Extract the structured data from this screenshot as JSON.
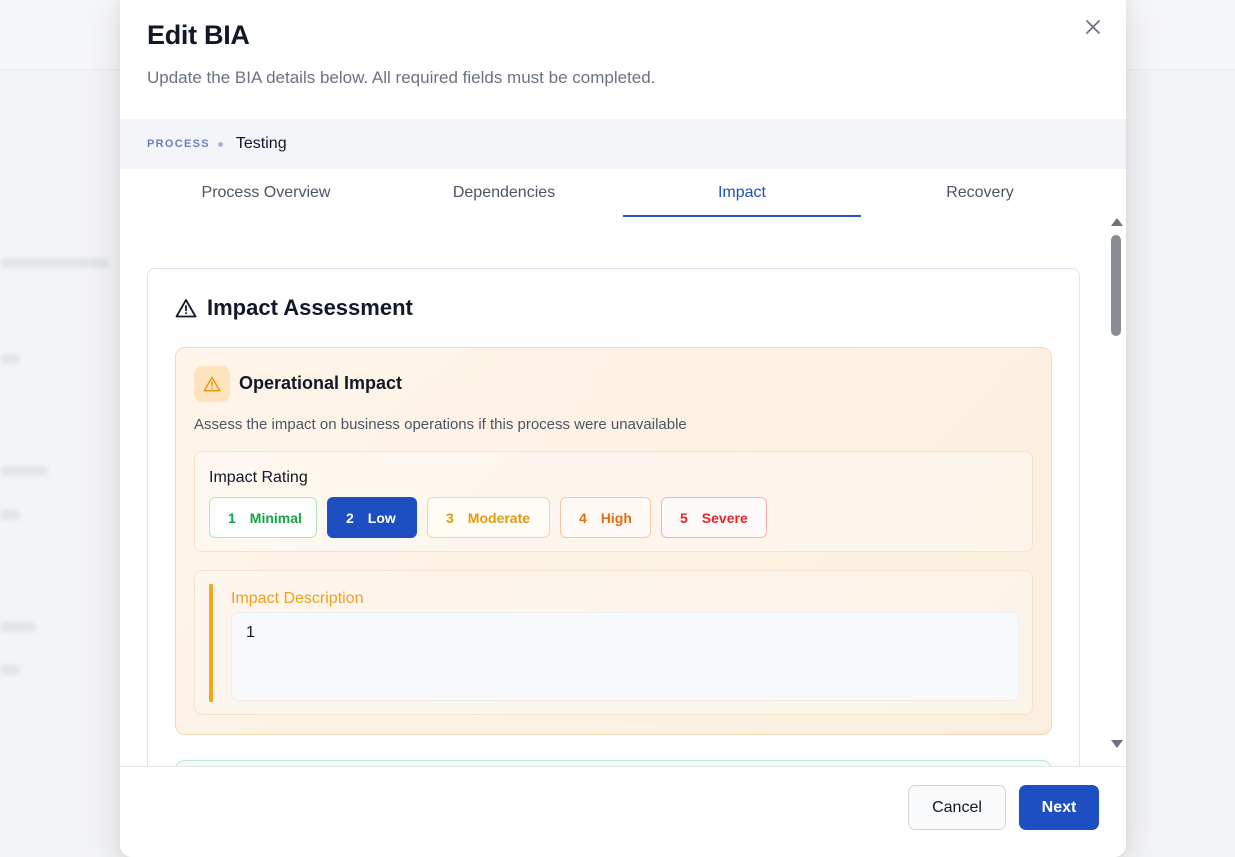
{
  "modal": {
    "title": "Edit BIA",
    "subtitle": "Update the BIA details below. All required fields must be completed.",
    "close_icon": "close-icon"
  },
  "process": {
    "label": "PROCESS",
    "name": "Testing"
  },
  "tabs": [
    {
      "label": "Process Overview",
      "active": false
    },
    {
      "label": "Dependencies",
      "active": false
    },
    {
      "label": "Impact",
      "active": true
    },
    {
      "label": "Recovery",
      "active": false
    }
  ],
  "impact_assessment": {
    "title": "Impact Assessment",
    "icon": "warning-triangle-icon",
    "operational": {
      "title": "Operational Impact",
      "icon": "warning-icon",
      "description": "Assess the impact on business operations if this process were unavailable",
      "rating_label": "Impact Rating",
      "ratings": [
        {
          "num": "1",
          "label": "Minimal",
          "color": "#16a34a",
          "selected": false
        },
        {
          "num": "2",
          "label": "Low",
          "color": "#1e4fc2",
          "selected": true
        },
        {
          "num": "3",
          "label": "Moderate",
          "color": "#e39a0f",
          "selected": false
        },
        {
          "num": "4",
          "label": "High",
          "color": "#ea6b10",
          "selected": false
        },
        {
          "num": "5",
          "label": "Severe",
          "color": "#dc2626",
          "selected": false
        }
      ],
      "impact_description_label": "Impact Description",
      "impact_description_value": "1"
    }
  },
  "footer": {
    "cancel_label": "Cancel",
    "next_label": "Next"
  },
  "colors": {
    "accent": "#1e4fc2",
    "warning": "#f0a81e"
  }
}
